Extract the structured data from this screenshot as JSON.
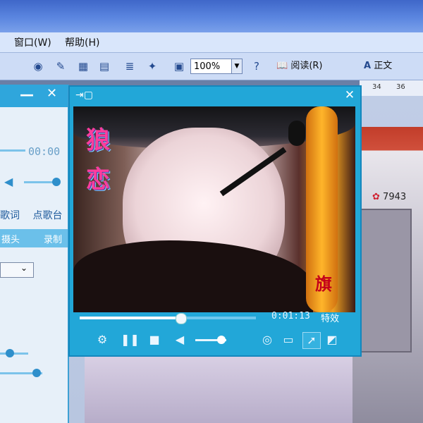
{
  "menubar": {
    "items": [
      "窗口(W)",
      "帮助(H)"
    ]
  },
  "toolbar": {
    "zoom": "100%",
    "read_label": "阅读(R)",
    "style_label": "正文",
    "icons": [
      "research-icon",
      "edit-icon",
      "table-icon",
      "excel-icon",
      "columns-icon",
      "drawing-icon",
      "doc-map-icon",
      "help-icon"
    ]
  },
  "ruler": {
    "marks": [
      "34",
      "36"
    ]
  },
  "room": {
    "count": "7943"
  },
  "left_panel": {
    "time": "00:00",
    "lyrics_label": "歌词",
    "karaoke_label": "点歌台",
    "tabs": [
      "摄头",
      "录制"
    ]
  },
  "video_window": {
    "captions": [
      "狼",
      "恋",
      "旗"
    ],
    "time": "0:01:13",
    "effect_label": "特效",
    "progress": 0.57,
    "volume": 0.85,
    "controls": [
      "settings-icon",
      "pause-icon",
      "stop-icon",
      "volume-icon",
      "user-icon",
      "camera-icon",
      "cursor-icon",
      "fullscreen-icon"
    ]
  }
}
